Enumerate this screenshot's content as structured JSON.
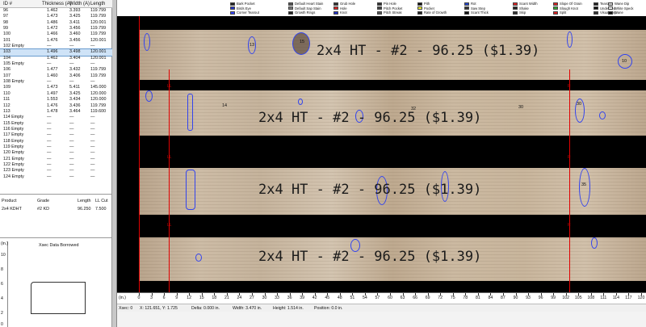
{
  "grid": {
    "headers": {
      "id": "ID #",
      "thickness": "Thickness (A)",
      "width": "Width (A)",
      "length": "Length"
    },
    "rows": [
      {
        "id": "96",
        "t": "1.462",
        "w": "3.393",
        "l": "119.799"
      },
      {
        "id": "97",
        "t": "1.473",
        "w": "3.425",
        "l": "119.799"
      },
      {
        "id": "98",
        "t": "1.486",
        "w": "3.411",
        "l": "120.001"
      },
      {
        "id": "99",
        "t": "1.472",
        "w": "3.456",
        "l": "119.799"
      },
      {
        "id": "100",
        "t": "1.466",
        "w": "3.460",
        "l": "119.799"
      },
      {
        "id": "101",
        "t": "1.476",
        "w": "3.456",
        "l": "120.001"
      },
      {
        "id": "102 Empty",
        "t": "—",
        "w": "—",
        "l": "—"
      },
      {
        "id": "103",
        "t": "1.496",
        "w": "3.498",
        "l": "120.001"
      },
      {
        "id": "104",
        "t": "1.462",
        "w": "3.404",
        "l": "120.001"
      },
      {
        "id": "105 Empty",
        "t": "—",
        "w": "—",
        "l": "—"
      },
      {
        "id": "106",
        "t": "1.477",
        "w": "3.432",
        "l": "119.799"
      },
      {
        "id": "107",
        "t": "1.460",
        "w": "3.406",
        "l": "119.799"
      },
      {
        "id": "108 Empty",
        "t": "—",
        "w": "—",
        "l": "—"
      },
      {
        "id": "109",
        "t": "1.473",
        "w": "5.411",
        "l": "145.000"
      },
      {
        "id": "110",
        "t": "1.497",
        "w": "3.425",
        "l": "120.000"
      },
      {
        "id": "111",
        "t": "1.553",
        "w": "3.434",
        "l": "120.000"
      },
      {
        "id": "112",
        "t": "1.476",
        "w": "3.436",
        "l": "119.799"
      },
      {
        "id": "113",
        "t": "1.478",
        "w": "3.464",
        "l": "119.600"
      },
      {
        "id": "114 Empty",
        "t": "—",
        "w": "—",
        "l": "—"
      },
      {
        "id": "115 Empty",
        "t": "—",
        "w": "—",
        "l": "—"
      },
      {
        "id": "116 Empty",
        "t": "—",
        "w": "—",
        "l": "—"
      },
      {
        "id": "117 Empty",
        "t": "—",
        "w": "—",
        "l": "—"
      },
      {
        "id": "118 Empty",
        "t": "—",
        "w": "—",
        "l": "—"
      },
      {
        "id": "119 Empty",
        "t": "—",
        "w": "—",
        "l": "—"
      },
      {
        "id": "120 Empty",
        "t": "—",
        "w": "—",
        "l": "—"
      },
      {
        "id": "121 Empty",
        "t": "—",
        "w": "—",
        "l": "—"
      },
      {
        "id": "122 Empty",
        "t": "—",
        "w": "—",
        "l": "—"
      },
      {
        "id": "123 Empty",
        "t": "—",
        "w": "—",
        "l": "—"
      },
      {
        "id": "124 Empty",
        "t": "—",
        "w": "—",
        "l": "—"
      }
    ],
    "selected_id": "103"
  },
  "product": {
    "headers": {
      "product": "Product",
      "grade": "Grade",
      "length": "Length",
      "ll_cut": "LL Cut"
    },
    "row": {
      "product": "2x4 KDHT",
      "grade": "#2 KD",
      "length": "96.250",
      "ll_cut": "7.500"
    }
  },
  "xsec": {
    "title": "Xsec Data Borrowed",
    "unit": "(in.)",
    "y_labels": [
      "10",
      "8",
      "6",
      "4",
      "2",
      "0"
    ]
  },
  "legend": [
    {
      "label": "Bark Pocket",
      "color": "#222222"
    },
    {
      "label": "Birds Eye",
      "color": "#2233cc"
    },
    {
      "label": "Corner Tearout",
      "color": "#3344ff"
    },
    {
      "label": "Default Heart Stain",
      "color": "#555555"
    },
    {
      "label": "Default Sap Stain",
      "color": "#777777"
    },
    {
      "label": "Growth Rings",
      "color": "#222222"
    },
    {
      "label": "Grub Hole",
      "color": "#333333"
    },
    {
      "label": "Hole",
      "color": "#dd2222"
    },
    {
      "label": "Knot",
      "color": "#2233cc"
    },
    {
      "label": "Pin Hole",
      "color": "#333333"
    },
    {
      "label": "Pitch Pocket",
      "color": "#444444"
    },
    {
      "label": "Pitch Streak",
      "color": "#555555"
    },
    {
      "label": "Pith",
      "color": "#111111"
    },
    {
      "label": "Pocket",
      "color": "#eeee33"
    },
    {
      "label": "Rate of Growth",
      "color": "#222222"
    },
    {
      "label": "Rot",
      "color": "#2244cc"
    },
    {
      "label": "Saw Step",
      "color": "#333333"
    },
    {
      "label": "Scant Thick",
      "color": "#111111"
    },
    {
      "label": "Scant Width",
      "color": "#dd2222"
    },
    {
      "label": "Shake",
      "color": "#222222"
    },
    {
      "label": "Skip",
      "color": "#333333"
    },
    {
      "label": "Slope Of Grain",
      "color": "#dd2222"
    },
    {
      "label": "Slough Knot",
      "color": "#33aa33"
    },
    {
      "label": "Split",
      "color": "#dd2222"
    },
    {
      "label": "Tearout",
      "color": "#222222"
    },
    {
      "label": "Undefined",
      "color": "#111111"
    },
    {
      "label": "Visual Skip",
      "color": "#333333"
    },
    {
      "label": "Wane Dip",
      "color": "#cccccc"
    },
    {
      "label": "White Speck",
      "color": "#eeeeee"
    },
    {
      "label": "Wane",
      "color": "#111111"
    }
  ],
  "boards": [
    {
      "text": "2x4   HT  - #2   -  96.25 ($1.39)"
    },
    {
      "text": "2x4   HT  - #2   -  96.25 ($1.39)"
    },
    {
      "text": "2x4   HT  - #2   -  96.25 ($1.39)"
    },
    {
      "text": "2x4   HT  - #2   -  96.25 ($1.39)"
    }
  ],
  "defect_labels": [
    "15",
    "13",
    "10",
    "14",
    "30",
    "32",
    "30",
    "35",
    "13",
    "11"
  ],
  "cut_labels": {
    "ll": "LL",
    "r": "R"
  },
  "ruler": {
    "unit": "(in.)",
    "labels": [
      "0",
      "3",
      "6",
      "9",
      "12",
      "15",
      "18",
      "21",
      "24",
      "27",
      "30",
      "33",
      "36",
      "39",
      "42",
      "45",
      "48",
      "51",
      "54",
      "57",
      "60",
      "63",
      "66",
      "69",
      "72",
      "75",
      "78",
      "81",
      "84",
      "87",
      "90",
      "93",
      "96",
      "99",
      "102",
      "105",
      "108",
      "111",
      "114",
      "117",
      "120"
    ]
  },
  "status": {
    "xsec": "Xsec: 0",
    "xy": "X: 121.651, Y: 1.725",
    "delta": "Delta: 0.000 in.",
    "width": "Width: 3.470 in.",
    "height": "Height: 1.514 in.",
    "position": "Position: 0.0 in."
  }
}
